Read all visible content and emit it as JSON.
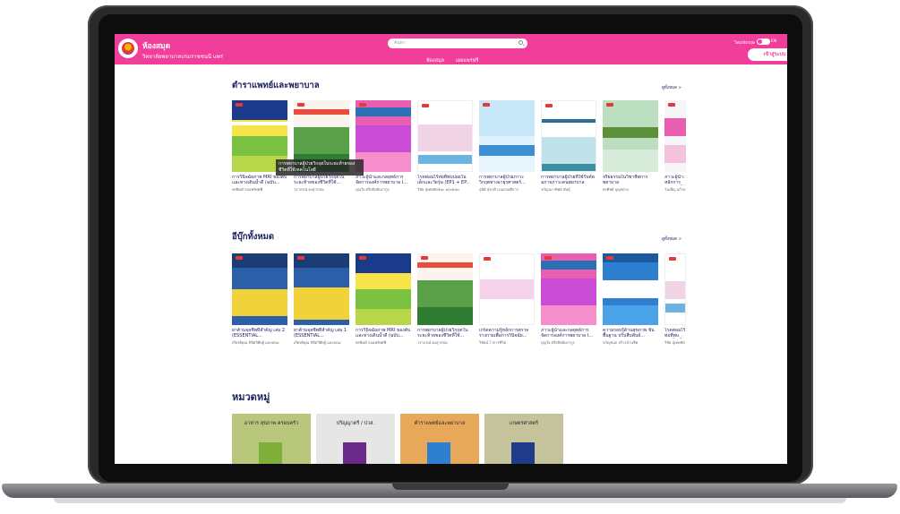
{
  "header": {
    "title": "ห้องสมุด",
    "subtitle": "วิทยาลัยพยาบาลบรมราชชนนี แพร่",
    "search_placeholder": "ค้นหา",
    "nav": [
      "ห้องสมุด",
      "เผยแพร่ฟรี"
    ],
    "lang_label": "ไทย/อังกฤษ",
    "lang_en": "EN",
    "login_label": "เข้าสู่ระบบ"
  },
  "sections": [
    {
      "title": "ตำราแพทย์และพยาบาล",
      "see_all": "ดูทั้งหมด >",
      "books": [
        {
          "title": "การวินิจฉัยภาพ MRI ของตับและทางเดินน้ำดี (ฉบับ...",
          "author": "พรพิมพ์ กอแพร์ทศฟี"
        },
        {
          "title": "การพยาบาลผู้ป่วยวิกฤตในระยะท้ายของชีวิตที่ใช้...",
          "author": "วราภรณ์ คงสุวรรณ"
        },
        {
          "title": "ภาวะผู้นำและกลยุทธ์การจัดการองค์การพยาบาล I...",
          "author": "บุญใจ ศรีสถิตย์นรากูร"
        },
        {
          "title": "โรคต่อมไร้ท่อที่พบบ่อยในเด็กและวัยรุ่น (EP1 + EP...",
          "author": "วิชัย สุเทพชัยชนะ และคณะ"
        },
        {
          "title": "การพยาบาลผู้ป่วยภาวะวิกฤตทางอายุรศาสตร์...",
          "author": "สุนีย์ สุขวดี บงแสงนทีการ"
        },
        {
          "title": "การพยาบาลผู้ป่วยที่ใช้รับคัดฉกาจภาวะคนพยาบาลศาสตร์...",
          "author": "ขวัญนภาทิพย์ พันธุ์"
        },
        {
          "title": "จริยธรรมในวิชาชีพการพยาบาล",
          "author": "พรศิพย์ บุญสดวง"
        },
        {
          "title": "ภาวะผู้นำ: หลักการประยุกต์ใช้ในการ...",
          "author": "วันเพ็ญ แก้วปาน"
        }
      ]
    },
    {
      "title": "อีบุ๊กทั้งหมด",
      "see_all": "ดูทั้งหมด >",
      "books": [
        {
          "title": "ยาต้านจุลชีพที่สำคัญ เล่ม 2 (ESSENTIAL...",
          "author": "เกียรติคุณ ลิขิตวิศิษฐ์ และคณะ"
        },
        {
          "title": "ยาต้านจุลชีพที่สำคัญ เล่ม 1 (ESSENTIAL...",
          "author": "เกียรติคุณ ลิขิตวิศิษฐ์ และคณะ"
        },
        {
          "title": "การวินิจฉัยภาพ MRI ของตับและทางเดินน้ำดี (ฉบับ...",
          "author": "พรพิมพ์ กอแพร์ทศฟี"
        },
        {
          "title": "การพยาบาลผู้ป่วยวิกฤตในระยะท้ายของชีวิตที่ใช้...",
          "author": "วราภรณ์ คงสุวรรณ"
        },
        {
          "title": "เกร็ดความรู้หลักการตรวจร่างกายเพื่อการวินิจฉัย...",
          "author": "วิชัยน์ โวการชีวิต"
        },
        {
          "title": "ภาวะผู้นำและกลยุทธ์การจัดการองค์การพยาบาล I...",
          "author": "บุญใจ ศรีสถิตย์นรากูร"
        },
        {
          "title": "ความรอบรู้ด้านสุขภาพ ขั้นพื้นฐาน ปรับสืบพันธ์...",
          "author": "ขวัญชนก สร้างบ้านชีพ"
        },
        {
          "title": "โรคต่อมไร้ท่อที่พบบ่อยในเด็กและวัยรุ่น",
          "author": "วิชัย สุเทพชัย"
        }
      ]
    }
  ],
  "tooltip": "การพยาบาลผู้ป่วยวิกฤตในระยะท้ายของชีวิตที่ใช้เทคโนโลยี",
  "categories_title": "หมวดหมู่",
  "categories": [
    {
      "label": "อาหาร สุขภาพ ครอบครัว"
    },
    {
      "label": "ปริญญาตรี / ปวส."
    },
    {
      "label": "ตำราแพทย์และพยาบาล"
    },
    {
      "label": "เกษตรศาสตร์"
    }
  ],
  "colors": {
    "header": "#f23e9b",
    "heading": "#1b1f5c"
  }
}
